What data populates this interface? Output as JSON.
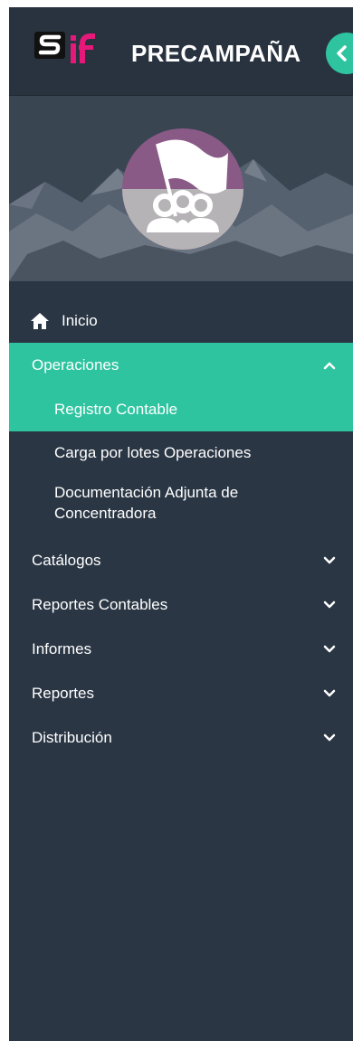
{
  "header": {
    "logo_text": "SIF",
    "title": "PRECAMPAÑA"
  },
  "colors": {
    "sidebar_bg": "#2a3644",
    "accent": "#2ec4a0",
    "logo_pink": "#e6197a",
    "avatar_purple": "#8a5a86"
  },
  "menu": {
    "home": {
      "label": "Inicio",
      "icon": "home-icon"
    },
    "operaciones": {
      "label": "Operaciones",
      "expanded": true,
      "items": [
        {
          "label": "Registro Contable",
          "active": true
        },
        {
          "label": "Carga por lotes Operaciones"
        },
        {
          "label": "Documentación Adjunta de Concentradora"
        }
      ]
    },
    "catalogos": {
      "label": "Catálogos"
    },
    "reportes_contables": {
      "label": "Reportes Contables"
    },
    "informes": {
      "label": "Informes"
    },
    "reportes": {
      "label": "Reportes"
    },
    "distribucion": {
      "label": "Distribución"
    }
  }
}
